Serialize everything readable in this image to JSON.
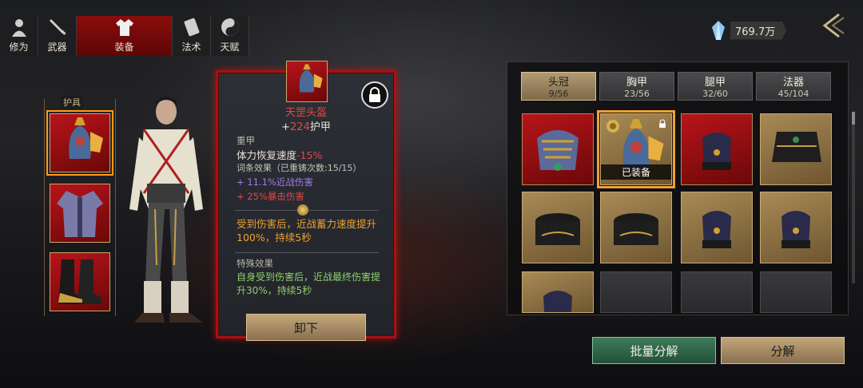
{
  "nav": {
    "tabs": [
      {
        "label": "修为",
        "icon": "cultivation-icon"
      },
      {
        "label": "武器",
        "icon": "sword-icon"
      },
      {
        "label": "装备",
        "icon": "robe-icon",
        "active": true
      },
      {
        "label": "法术",
        "icon": "scroll-icon"
      },
      {
        "label": "天赋",
        "icon": "yin-yang-icon"
      }
    ]
  },
  "currency": {
    "value": "769.7万",
    "icon": "crystal-icon"
  },
  "equip_slots": {
    "title": "护具",
    "items": [
      {
        "name": "helmet-slot",
        "icon": "helmet-icon",
        "selected": true
      },
      {
        "name": "chest-slot",
        "icon": "armor-icon"
      },
      {
        "name": "boots-slot",
        "icon": "boots-icon"
      }
    ]
  },
  "item_detail": {
    "name": "天罡头盔",
    "armor_prefix": "+",
    "armor_value": "224",
    "armor_suffix": "护甲",
    "type": "重甲",
    "stat_label": "体力恢复速度",
    "stat_value": "-15%",
    "recast": "词条效果（已重铸次数:15/15）",
    "affixes": [
      "+ 11.1%近战伤害",
      "+ 25%暴击伤害"
    ],
    "effect": "受到伤害后，近战蓄力速度提升100%，持续5秒",
    "special_title": "特殊效果",
    "special": "自身受到伤害后，近战最终伤害提升30%，持续5秒",
    "unequip_label": "卸下"
  },
  "inventory": {
    "tabs": [
      {
        "label": "头冠",
        "count": "9/56",
        "active": true
      },
      {
        "label": "胸甲",
        "count": "23/56"
      },
      {
        "label": "腿甲",
        "count": "32/60"
      },
      {
        "label": "法器",
        "count": "45/104"
      }
    ],
    "equipped_label": "已装备",
    "cells": [
      {
        "kind": "red",
        "icon": "crown-icon"
      },
      {
        "kind": "gold",
        "icon": "helmet-icon",
        "equipped": true
      },
      {
        "kind": "red",
        "icon": "hat-icon"
      },
      {
        "kind": "gold",
        "icon": "hood-icon"
      },
      {
        "kind": "gold",
        "icon": "cap-icon"
      },
      {
        "kind": "gold",
        "icon": "cap-icon"
      },
      {
        "kind": "gold",
        "icon": "hat-icon"
      },
      {
        "kind": "gold",
        "icon": "hat-icon"
      },
      {
        "kind": "gold",
        "icon": "hat-icon"
      },
      {
        "kind": "empty"
      },
      {
        "kind": "empty"
      },
      {
        "kind": "empty"
      }
    ]
  },
  "actions": {
    "bulk_label": "批量分解",
    "decompose_label": "分解"
  },
  "colors": {
    "accent_red": "#a81010",
    "gold": "#c8a872",
    "green_btn": "#3e7a5a"
  }
}
